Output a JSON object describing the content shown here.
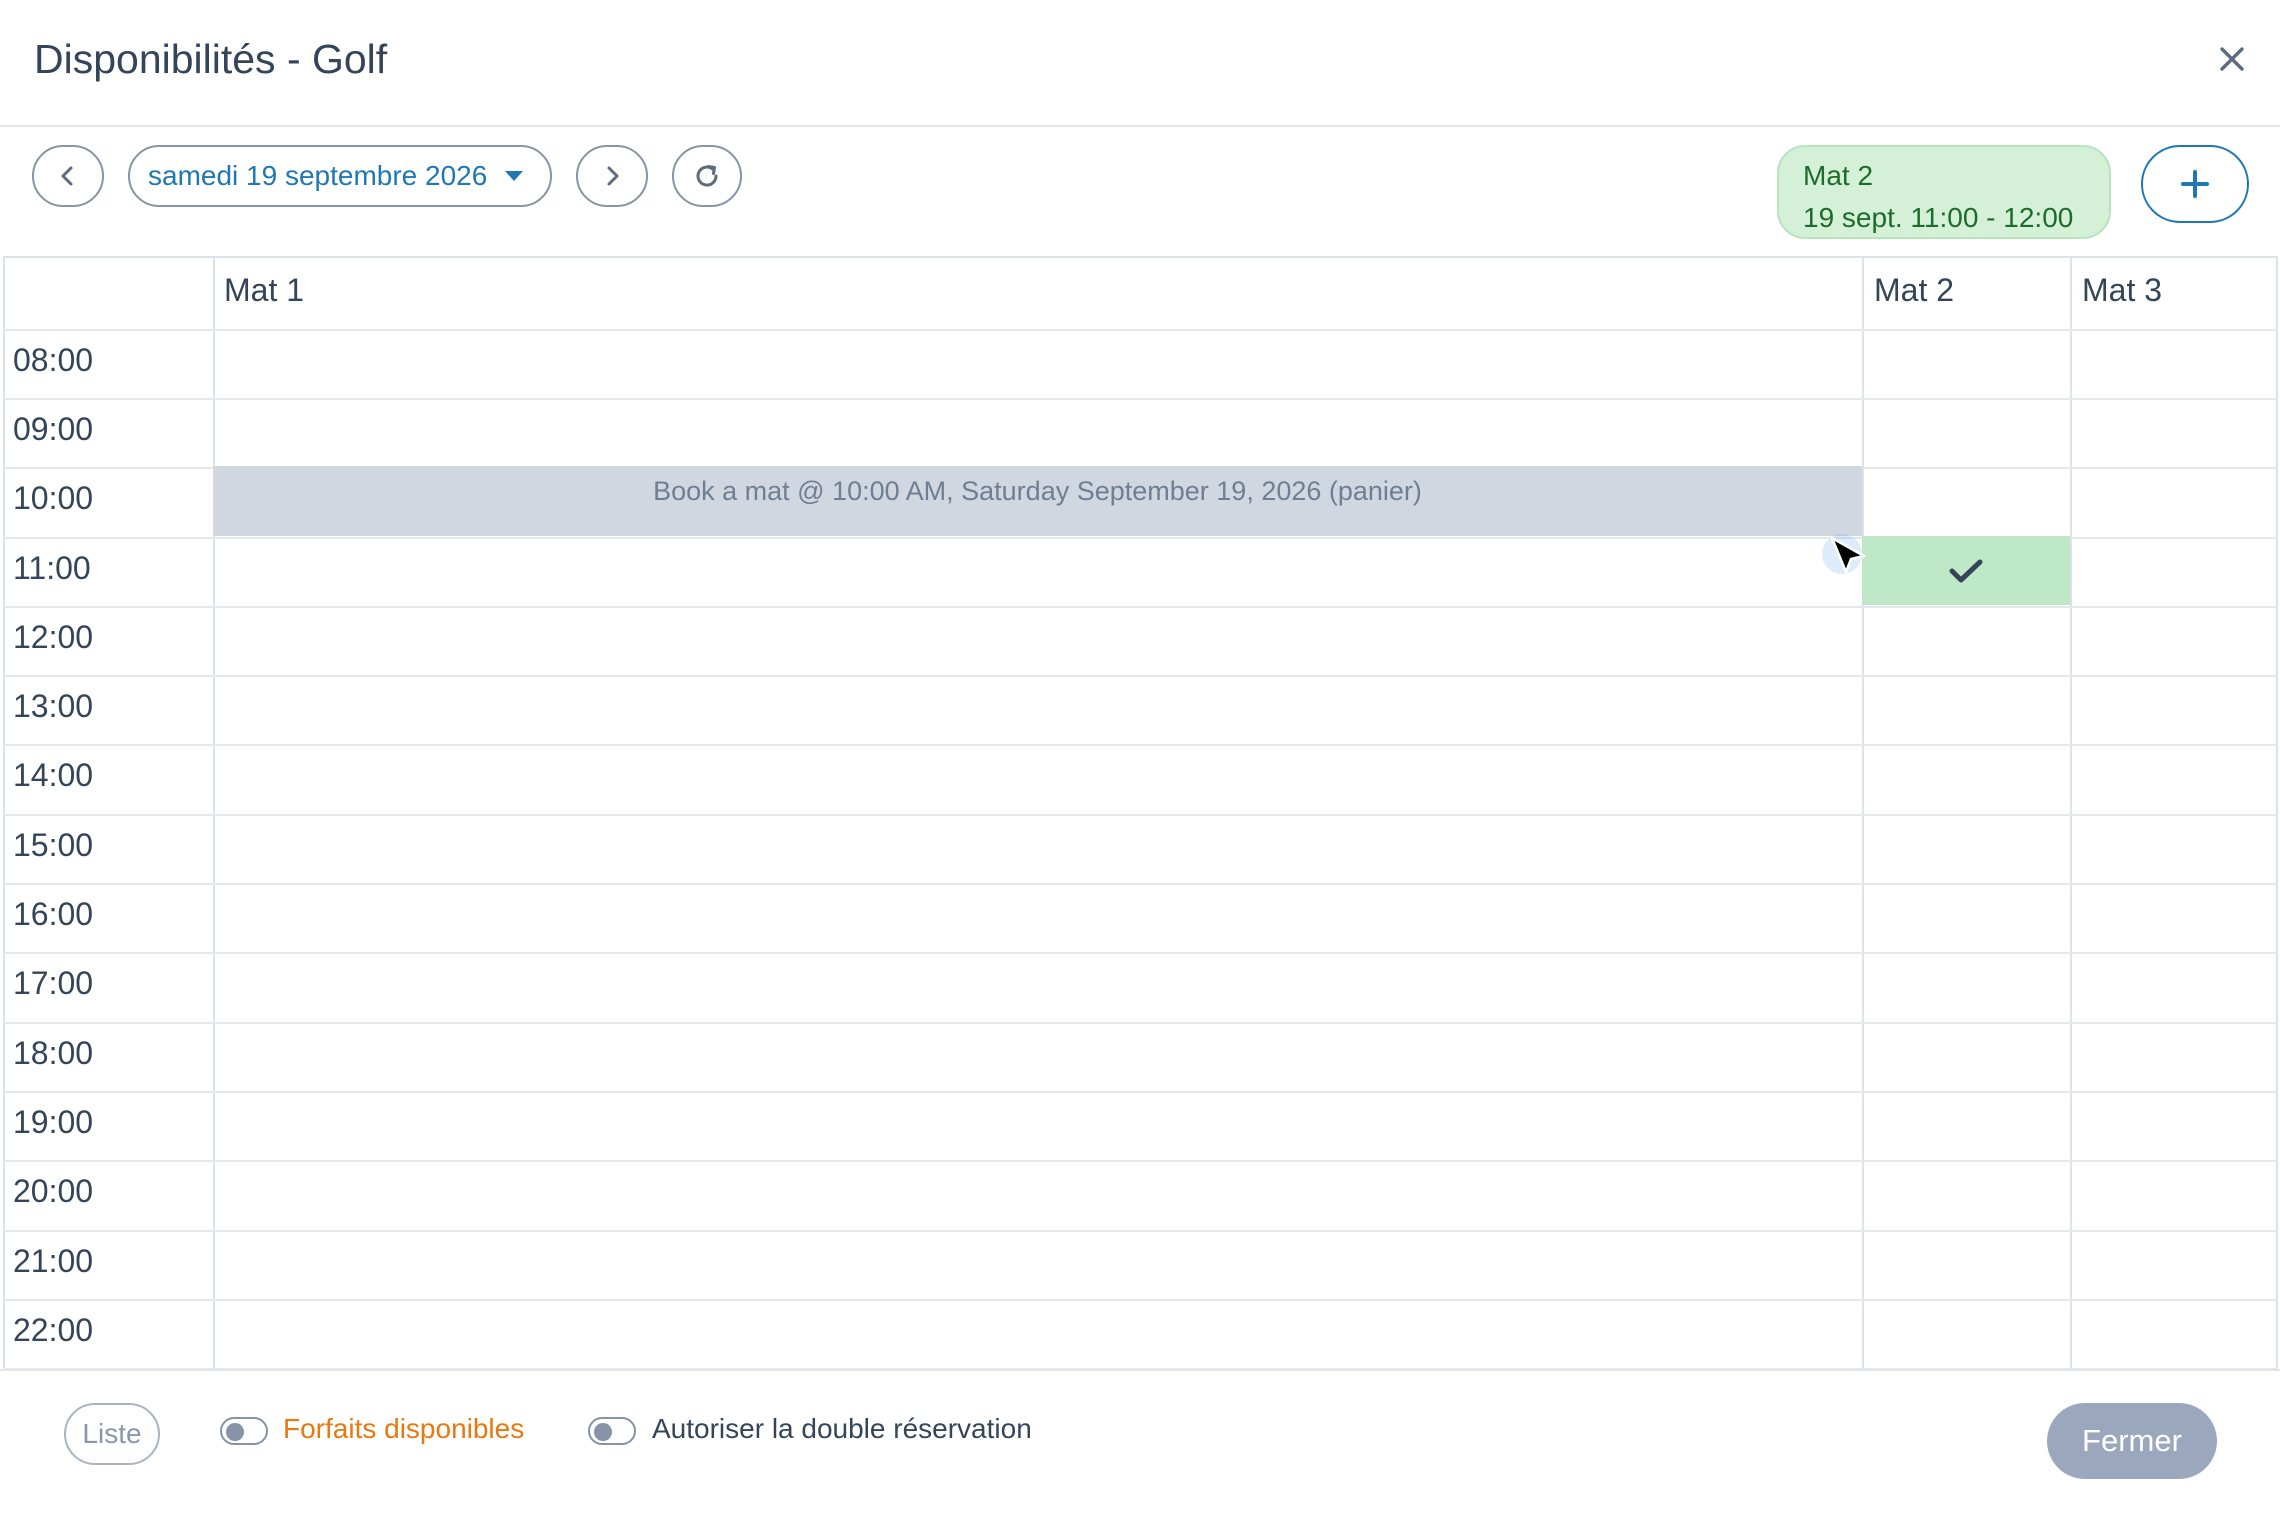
{
  "dialog": {
    "title": "Disponibilités - Golf"
  },
  "toolbar": {
    "date_label": "samedi 19 septembre 2026",
    "selection": {
      "resource": "Mat 2",
      "slot": "19 sept. 11:00 - 12:00"
    }
  },
  "grid": {
    "columns": [
      "Mat 1",
      "Mat 2",
      "Mat 3"
    ],
    "times": [
      "08:00",
      "09:00",
      "10:00",
      "11:00",
      "12:00",
      "13:00",
      "14:00",
      "15:00",
      "16:00",
      "17:00",
      "18:00",
      "19:00",
      "20:00",
      "21:00",
      "22:00"
    ],
    "booking": {
      "label": "Book a mat @ 10:00 AM, Saturday September 19, 2026 (panier)",
      "column": "Mat 1",
      "time": "10:00"
    },
    "selected_slot": {
      "column": "Mat 2",
      "time": "11:00"
    }
  },
  "footer": {
    "list_label": "Liste",
    "forfaits_label": "Forfaits disponibles",
    "double_label": "Autoriser la double réservation",
    "close_label": "Fermer"
  },
  "colors": {
    "accent": "#1f78b4",
    "selection_green": "#bfe9c6",
    "booking_gray": "#d1d7e1",
    "forfaits_orange": "#e8780f",
    "close_button": "#9aa7bc"
  },
  "icons": {
    "close": "close-icon",
    "prev": "chevron-left-icon",
    "next": "chevron-right-icon",
    "refresh": "refresh-icon",
    "add": "plus-icon",
    "check": "check-icon",
    "caret": "caret-down-icon",
    "cursor": "mouse-cursor-icon"
  }
}
